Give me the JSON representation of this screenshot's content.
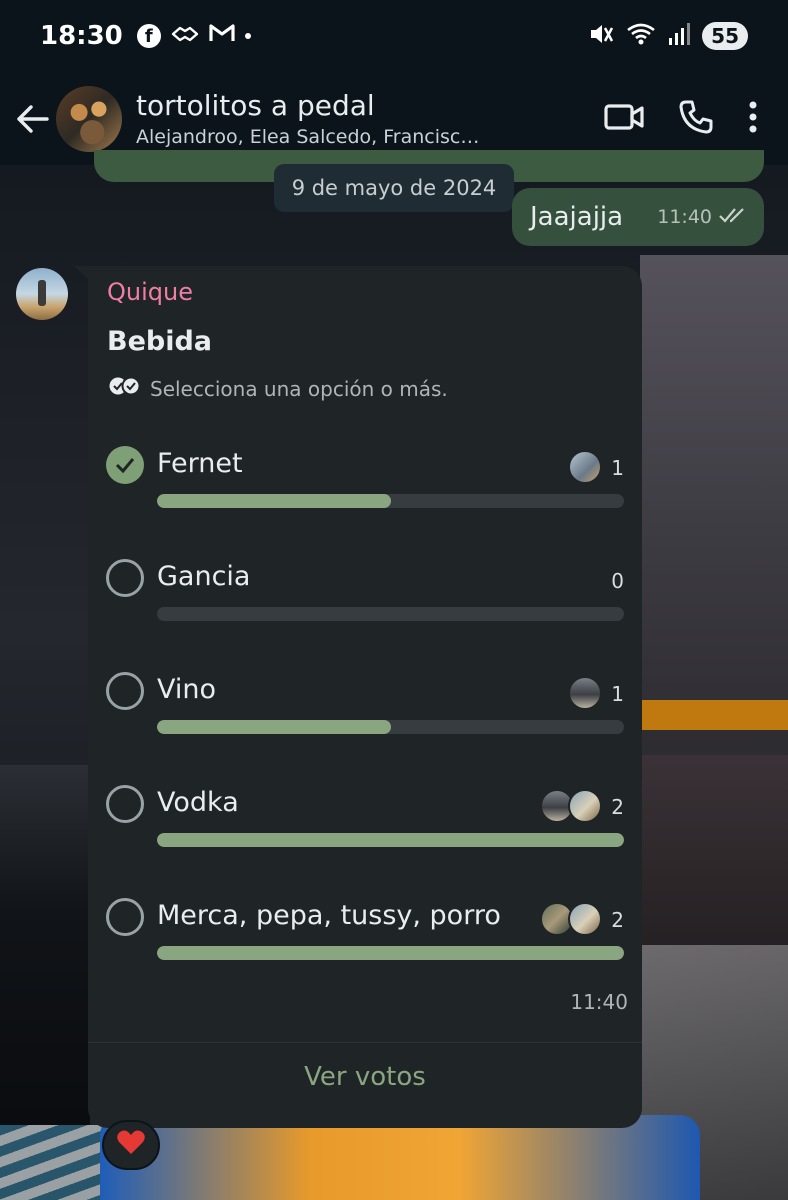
{
  "status_bar": {
    "time": "18:30",
    "battery": "55",
    "icons": [
      "facebook-icon",
      "handshake-icon",
      "gmail-icon",
      "mute-icon",
      "wifi-icon",
      "signal-icon"
    ]
  },
  "header": {
    "title": "tortolitos a pedal",
    "members": "Alejandroo, Elea Salcedo, Francisc…"
  },
  "date_chip": "9 de mayo de 2024",
  "outgoing": {
    "text": "Jaajajja",
    "time": "11:40"
  },
  "poll": {
    "sender": "Quique",
    "question": "Bebida",
    "hint": "Selecciona una opción o más.",
    "options": [
      {
        "label": "Fernet",
        "count": "1",
        "fraction": 0.5,
        "checked": true
      },
      {
        "label": "Gancia",
        "count": "0",
        "fraction": 0,
        "checked": false
      },
      {
        "label": "Vino",
        "count": "1",
        "fraction": 0.5,
        "checked": false
      },
      {
        "label": "Vodka",
        "count": "2",
        "fraction": 1,
        "checked": false
      },
      {
        "label": "Merca, pepa, tussy, porro",
        "count": "2",
        "fraction": 1,
        "checked": false
      }
    ],
    "time": "11:40",
    "view_votes": "Ver votos"
  },
  "reaction": "heart",
  "colors": {
    "accent_green": "#8aa680",
    "sender_pink": "#f07ea2",
    "bubble_dark": "#1f2426",
    "outgoing_bubble": "#35503c"
  }
}
